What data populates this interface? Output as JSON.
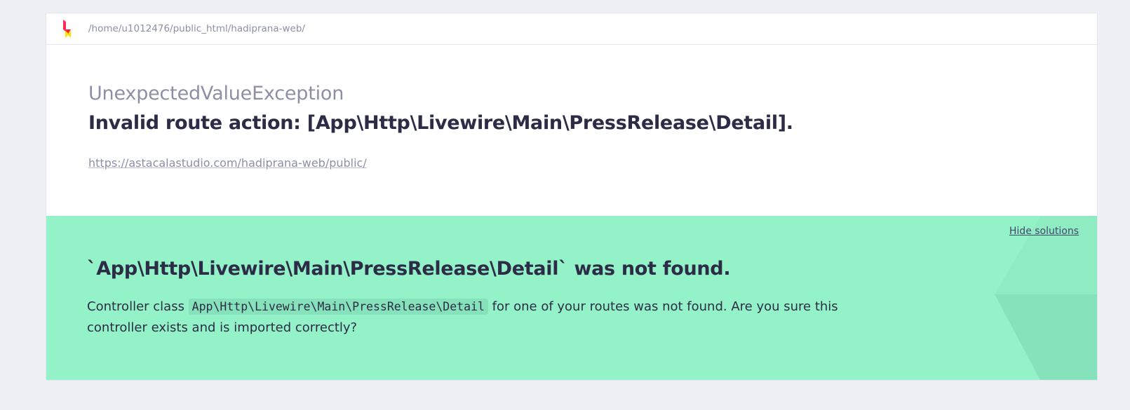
{
  "topbar": {
    "logo_icon": "ignition-logo-icon",
    "path": "/home/u1012476/public_html/hadiprana-web/"
  },
  "exception": {
    "class": "UnexpectedValueException",
    "message": "Invalid route action: [App\\Http\\Livewire\\Main\\PressRelease\\Detail].",
    "url": "https://astacalastudio.com/hadiprana-web/public/"
  },
  "solution": {
    "hide_label": "Hide solutions",
    "title": "`App\\Http\\Livewire\\Main\\PressRelease\\Detail` was not found.",
    "desc_before": "Controller class ",
    "desc_code": "App\\Http\\Livewire\\Main\\PressRelease\\Detail",
    "desc_after": " for one of your routes was not found. Are you sure this controller exists and is imported correctly?",
    "background_color": "#94f2c8"
  },
  "colors": {
    "page_background": "#eef0f5",
    "muted_text": "#8d8fa6",
    "heading_text": "#2c2c47",
    "logo_red": "#ff2d55",
    "logo_yellow": "#ffe000"
  }
}
